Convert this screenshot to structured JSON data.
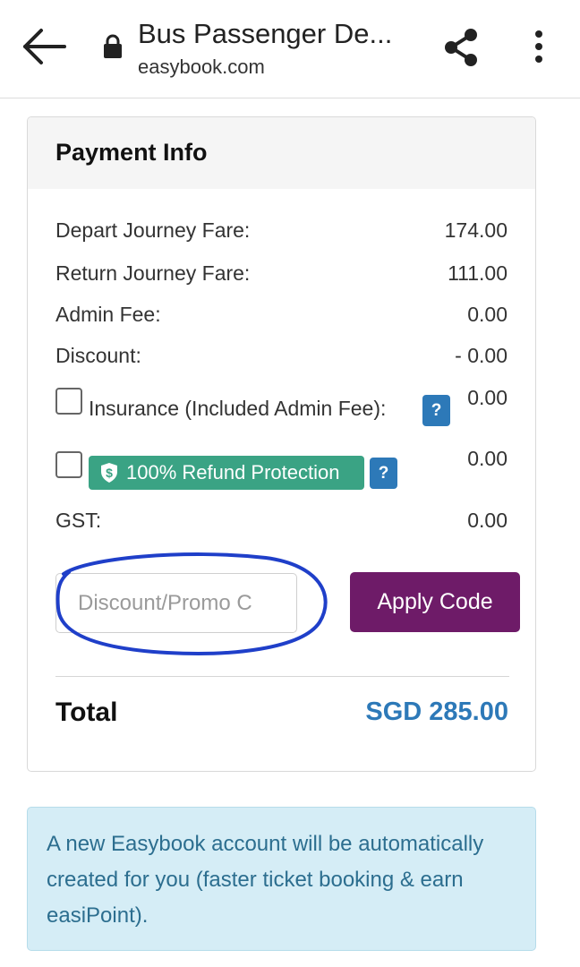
{
  "topbar": {
    "title": "Bus Passenger De...",
    "domain": "easybook.com",
    "icons": [
      "arrow-left-icon",
      "lock-icon",
      "share-icon",
      "more-vert-icon"
    ]
  },
  "payment": {
    "title": "Payment Info",
    "rows": [
      {
        "label": "Depart Journey Fare:",
        "value": "174.00"
      },
      {
        "label": "Return Journey Fare:",
        "value": "111.00"
      },
      {
        "label": "Admin Fee:",
        "value": "0.00"
      },
      {
        "label": "Discount:",
        "value": "- 0.00"
      }
    ],
    "insurance": {
      "label": "Insurance (Included Admin Fee):",
      "value": "0.00",
      "help": "?"
    },
    "refund": {
      "label": "100% Refund Protection",
      "value": "0.00",
      "help": "?"
    },
    "gst": {
      "label": "GST:",
      "value": "0.00"
    },
    "promo": {
      "placeholder": "Discount/Promo C",
      "value": ""
    },
    "apply_label": "Apply Code",
    "total": {
      "label": "Total",
      "value": "SGD 285.00"
    }
  },
  "info_message": "A new Easybook account will be automatically created for you (faster ticket booking & earn easiPoint).",
  "colors": {
    "accent_blue": "#2d79b8",
    "apply_purple": "#6e1b68",
    "refund_green": "#3aa384",
    "info_bg": "#d5edf6",
    "annotation_circle": "#1f3fc9"
  }
}
